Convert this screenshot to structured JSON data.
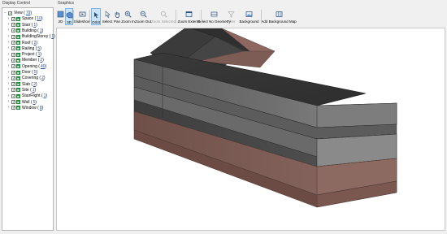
{
  "panels": {
    "display_control": "Display Control",
    "graphics": "Graphics"
  },
  "tree": [
    {
      "label": "View",
      "count": "79",
      "root": true
    },
    {
      "label": "Space",
      "count": "10"
    },
    {
      "label": "Stair",
      "count": "1"
    },
    {
      "label": "Building",
      "count": "1"
    },
    {
      "label": "BuildingStorey",
      "count": "1"
    },
    {
      "label": "Roof",
      "count": "2"
    },
    {
      "label": "Railing",
      "count": "5"
    },
    {
      "label": "Project",
      "count": "1"
    },
    {
      "label": "Member",
      "count": "2"
    },
    {
      "label": "Opening",
      "count": "40"
    },
    {
      "label": "Door",
      "count": "5"
    },
    {
      "label": "Covering",
      "count": "2"
    },
    {
      "label": "Slab",
      "count": "2"
    },
    {
      "label": "Site",
      "count": "1"
    },
    {
      "label": "StairFlight",
      "count": "1"
    },
    {
      "label": "Wall",
      "count": "5"
    },
    {
      "label": "Window",
      "count": "8"
    }
  ],
  "toolbar": [
    {
      "label": "2D",
      "icon": "2d-view-icon",
      "active": false,
      "disabled": false
    },
    {
      "label": "3D",
      "icon": "3d-view-icon",
      "active": true,
      "disabled": false
    },
    {
      "label": "Slideshow",
      "icon": "slideshow-icon",
      "active": false,
      "disabled": false
    },
    {
      "label": "Orbit",
      "icon": "orbit-icon",
      "active": true,
      "disabled": false
    },
    {
      "label": "Select",
      "icon": "select-icon",
      "active": false,
      "disabled": false
    },
    {
      "label": "Pan",
      "icon": "pan-hand-icon",
      "active": false,
      "disabled": false
    },
    {
      "label": "Zoom In",
      "icon": "zoom-in-icon",
      "active": false,
      "disabled": false
    },
    {
      "label": "Zoom Out",
      "icon": "zoom-out-icon",
      "active": false,
      "disabled": false
    },
    {
      "label": "Zoom Selected",
      "icon": "zoom-selected-icon",
      "active": false,
      "disabled": true
    },
    {
      "label": "Zoom Extents",
      "icon": "zoom-extents-icon",
      "active": false,
      "disabled": false
    },
    {
      "label": "Select No Geometry",
      "icon": "select-no-geometry-icon",
      "active": false,
      "disabled": false
    },
    {
      "label": "Filter",
      "icon": "filter-icon",
      "active": false,
      "disabled": true
    },
    {
      "label": "Background",
      "icon": "background-icon",
      "active": false,
      "disabled": false
    },
    {
      "label": "Add Background Map",
      "icon": "add-background-map-icon",
      "active": false,
      "disabled": false
    }
  ],
  "colors": {
    "tree_type_icon": "#1f8f3a",
    "count_link": "#1e4ea8",
    "active_button": "#cce4f7",
    "wall_dark": "#4a4a4a",
    "slab_brown": "#7a5a52"
  }
}
